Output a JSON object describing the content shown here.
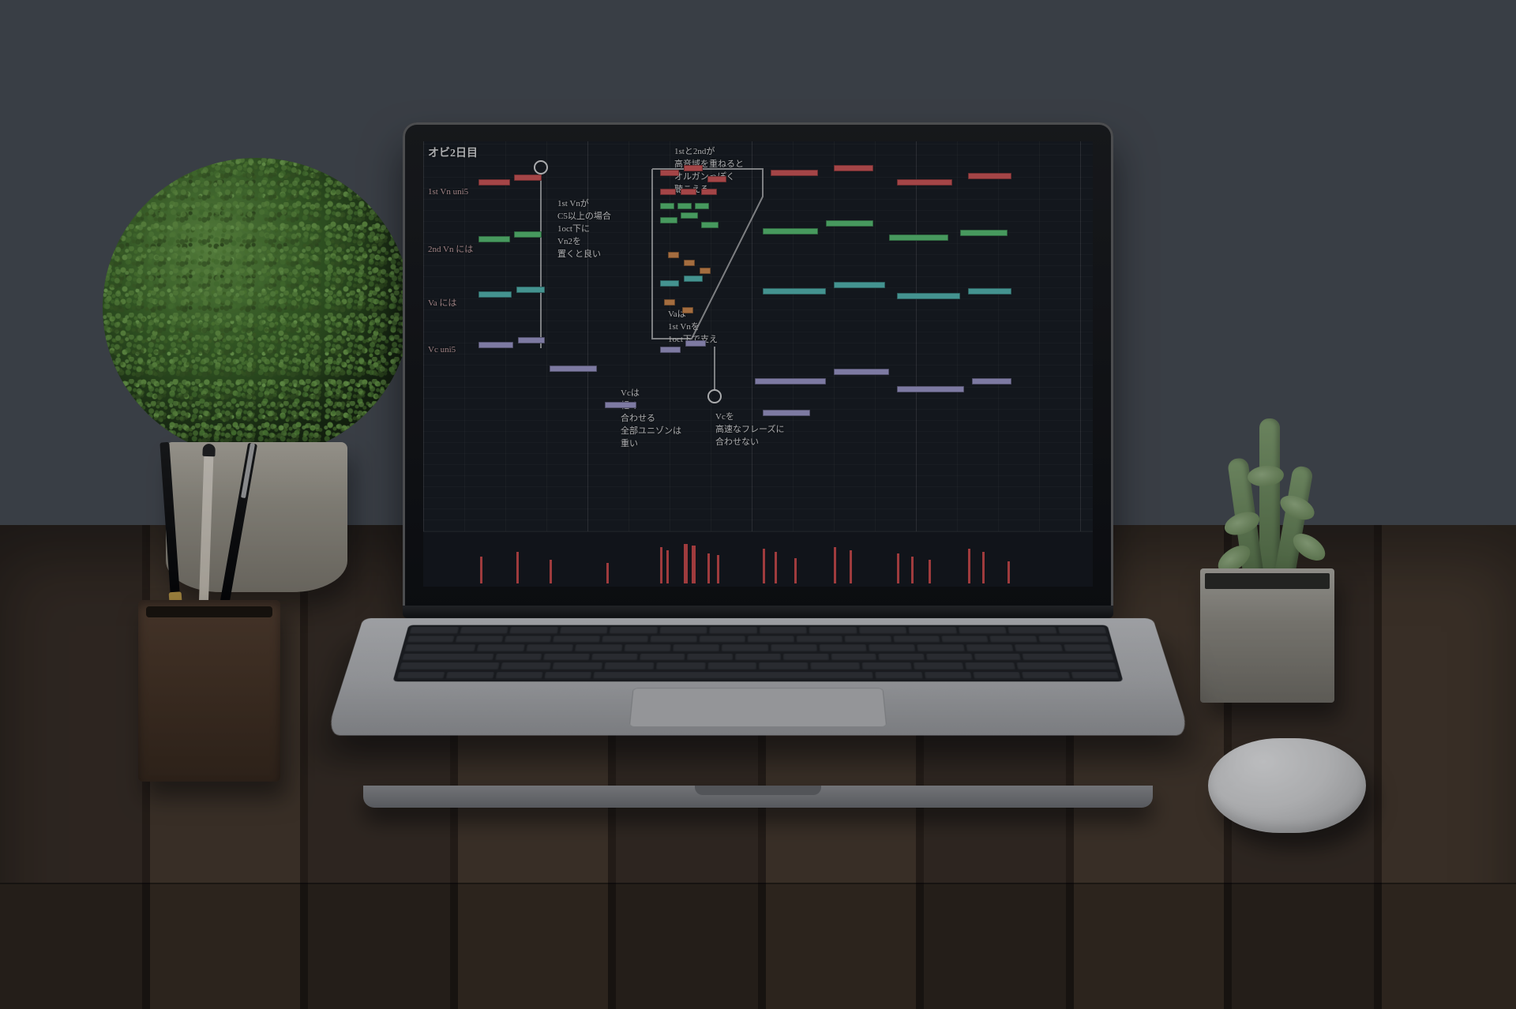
{
  "scene": {
    "description": "Photograph of a laptop on a wooden desk showing a DAW piano-roll / MIDI editor with handwritten Japanese orchestration annotations. A boxwood topiary and pencil cup sit to the left, a succulent in a concrete pot to the right, and a white computer mouse on the desk."
  },
  "screen": {
    "title": "オビ2日目",
    "tracks": [
      {
        "id": "vn1",
        "label": "1st Vn uni5",
        "color": "#e05a5a"
      },
      {
        "id": "vn2",
        "label": "2nd Vn には",
        "color": "#5fcf7a"
      },
      {
        "id": "va",
        "label": "Va には",
        "color": "#5bc7c0"
      },
      {
        "id": "vc",
        "label": "Vc uni5",
        "color": "#a9a4d9"
      }
    ],
    "annotations": [
      "1stと2ndが\n高音域を重ねると\nオルガンっぽく\n聴こえる",
      "1st Vnが\nC5以上の場合\n1oct下に\nVn2を\n置くと良い",
      "Vaは\n1st Vnを\n1oct下で支え",
      "Vcは\n軽く\n合わせる\n全部ユニゾンは\n重い",
      "Vcを\n高速なフレーズに\n合わせない"
    ],
    "velocity_lane_label": ""
  }
}
